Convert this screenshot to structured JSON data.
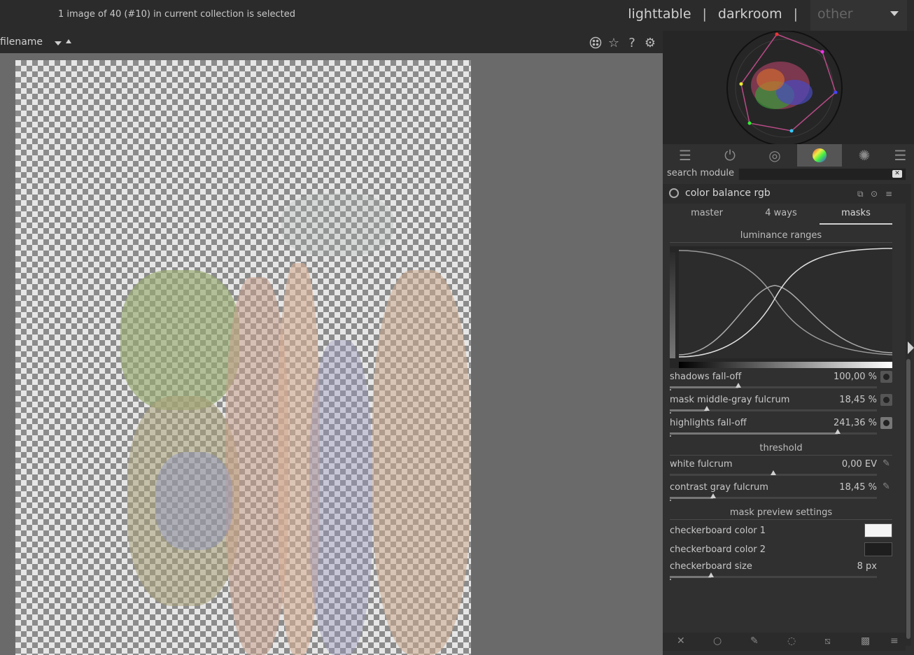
{
  "topbar": {
    "status": "1 image of 40 (#10) in current collection is selected",
    "views": [
      "lighttable",
      "darkroom"
    ],
    "separator": "|",
    "other": "other"
  },
  "filterbar": {
    "sort_label": "filename",
    "icons": [
      "grouping-icon",
      "star-icon",
      "help-icon",
      "gear-icon"
    ]
  },
  "module_groups": {
    "icons": [
      "sliders-icon",
      "power-icon",
      "base-icon",
      "color-wheel-icon",
      "effects-icon",
      "menu-icon"
    ],
    "active_index": 3
  },
  "search": {
    "label": "search module",
    "placeholder": ""
  },
  "module": {
    "name": "color balance rgb",
    "tabs": [
      "master",
      "4 ways",
      "masks"
    ],
    "active_tab": "masks"
  },
  "sections": {
    "luminance": "luminance ranges",
    "threshold": "threshold",
    "preview": "mask preview settings"
  },
  "sliders": [
    {
      "label": "shadows fall-off",
      "value": "100,00 %",
      "fraction": 0.33
    },
    {
      "label": "mask middle-gray fulcrum",
      "value": "18,45 %",
      "fraction": 0.18
    },
    {
      "label": "highlights fall-off",
      "value": "241,36 %",
      "fraction": 0.81
    },
    {
      "label": "white fulcrum",
      "value": "0,00 EV",
      "fraction": 0.5
    },
    {
      "label": "contrast gray fulcrum",
      "value": "18,45 %",
      "fraction": 0.21
    },
    {
      "label": "checkerboard size",
      "value": "8 px",
      "fraction": 0.2
    }
  ],
  "checkerboard": {
    "color1_label": "checkerboard color 1",
    "color1": "#f4f4f4",
    "color2_label": "checkerboard color 2",
    "color2": "#1e1e1e"
  },
  "bottom_icons": [
    "close-icon",
    "circle-icon",
    "pen-icon",
    "brush-icon",
    "gradient-icon",
    "checker-icon",
    "menu-icon"
  ]
}
